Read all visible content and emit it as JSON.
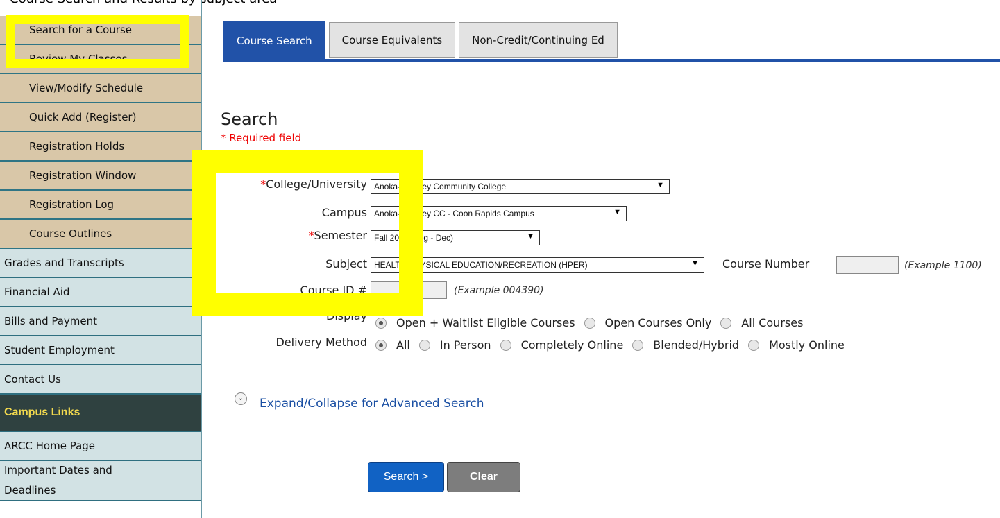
{
  "caption": "Course Search and Results by subject area",
  "sidebar": {
    "sub_items": [
      {
        "label": "Search for a Course"
      },
      {
        "label": "Review My Classes"
      },
      {
        "label": "View/Modify Schedule"
      },
      {
        "label": "Quick Add (Register)"
      },
      {
        "label": "Registration Holds"
      },
      {
        "label": "Registration Window"
      },
      {
        "label": "Registration Log"
      },
      {
        "label": "Course Outlines"
      }
    ],
    "top_items": [
      {
        "label": "Grades and Transcripts"
      },
      {
        "label": "Financial Aid"
      },
      {
        "label": "Bills and Payment"
      },
      {
        "label": "Student Employment"
      },
      {
        "label": "Contact Us"
      }
    ],
    "campus_links_header": "Campus Links",
    "campus_links": [
      {
        "label": "ARCC Home Page"
      },
      {
        "label_line1": "Important Dates and",
        "label_line2": "Deadlines"
      }
    ]
  },
  "tabs": [
    {
      "label": "Course Search",
      "active": true
    },
    {
      "label": "Course Equivalents",
      "active": false
    },
    {
      "label": "Non-Credit/Continuing Ed",
      "active": false
    }
  ],
  "search": {
    "title": "Search",
    "required_note": "* Required field",
    "college_label": "College/University",
    "college_value": "Anoka-Ramsey Community College",
    "campus_label": "Campus",
    "campus_value": "Anoka-Ramsey CC - Coon Rapids Campus",
    "semester_label": "Semester",
    "semester_value": "Fall 2017 (Aug - Dec)",
    "subject_label": "Subject",
    "subject_value": "HEALTH/PHYSICAL EDUCATION/RECREATION (HPER)",
    "course_number_label": "Course Number",
    "course_number_example": "(Example 1100)",
    "course_id_label": "Course ID #",
    "course_id_example": "(Example 004390)",
    "display_label": "Display",
    "display_options": [
      "Open + Waitlist Eligible Courses",
      "Open Courses Only",
      "All Courses"
    ],
    "display_selected": "Open + Waitlist Eligible Courses",
    "delivery_label": "Delivery Method",
    "delivery_options": [
      "All",
      "In Person",
      "Completely Online",
      "Blended/Hybrid",
      "Mostly Online"
    ],
    "delivery_selected": "All",
    "advanced_link": "Expand/Collapse for Advanced Search",
    "search_button": "Search >",
    "clear_button": "Clear"
  },
  "colors": {
    "tab_active": "#2152a8",
    "highlight": "#ffff00",
    "sidebar_sub": "#d9c7a8",
    "sidebar_top": "#d2e2e4",
    "campus_header_bg": "#2f4140",
    "campus_header_text": "#f2d94e"
  },
  "icons": {
    "expand": "chevron-down-circle-icon",
    "select_arrow": "triangle-down-icon"
  }
}
